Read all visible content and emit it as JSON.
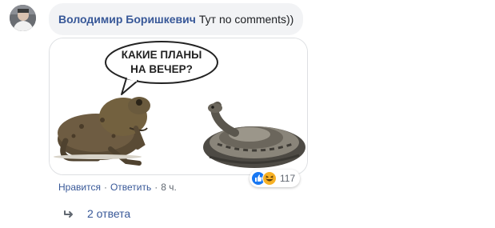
{
  "comment": {
    "author": "Володимир Боришкевич",
    "text": "Тут no comments))",
    "attachment": {
      "speech_bubble_line1": "КАКИЕ ПЛАНЫ",
      "speech_bubble_line2": "НА ВЕЧЕР?"
    },
    "reactions": {
      "icons": [
        "like-icon",
        "haha-icon"
      ],
      "count": "117",
      "colors": {
        "like": "#1877f2",
        "haha": "#f7b125"
      }
    },
    "actions": {
      "like": "Нравится",
      "separator": "·",
      "reply": "Ответить",
      "time": "8 ч."
    }
  },
  "replies": {
    "icon": "reply-arrow-icon",
    "label": "2 ответа"
  },
  "colors": {
    "author_link": "#385898",
    "bubble_bg": "#f2f3f5",
    "meta_text": "#606770"
  }
}
